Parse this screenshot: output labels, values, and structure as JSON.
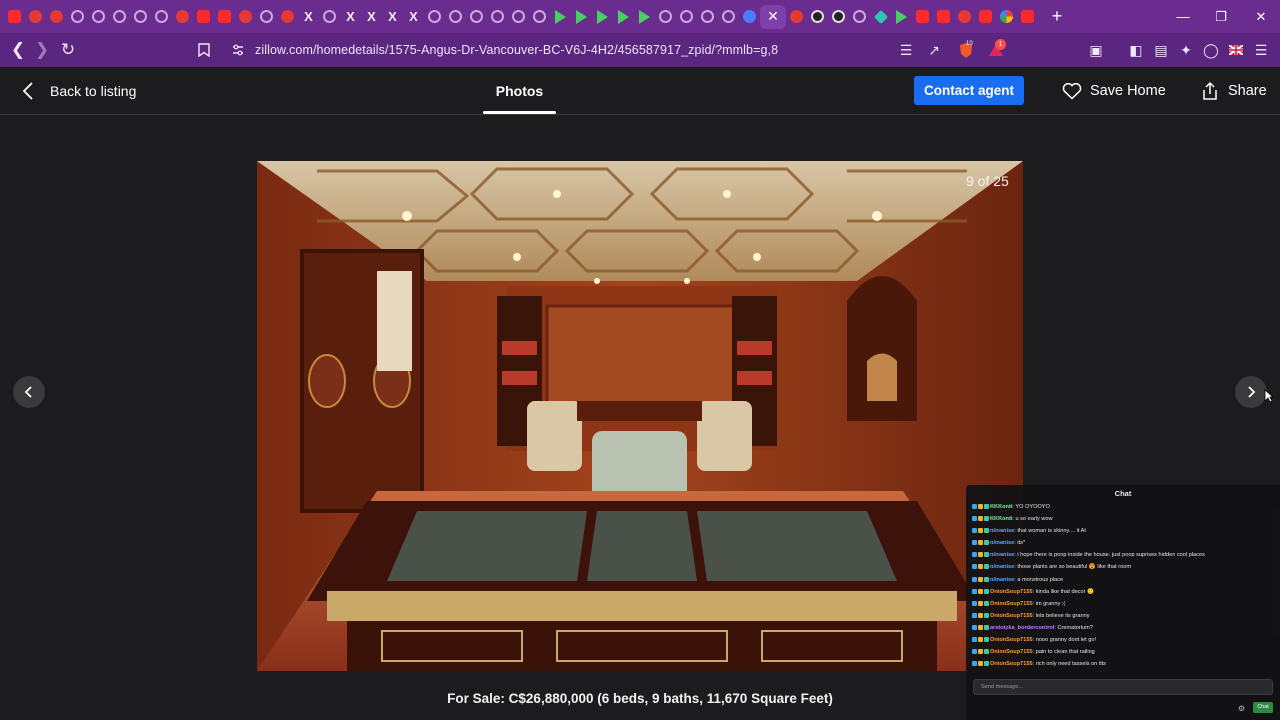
{
  "browser": {
    "url": "zillow.com/homedetails/1575-Angus-Dr-Vancouver-BC-V6J-4H2/456587917_zpid/?mmlb=g,8",
    "tab_icons": [
      "youtube-icon",
      "twitch-icon",
      "twitch-icon",
      "circle-icon",
      "circle-icon",
      "circle-icon",
      "circle-icon",
      "circle-icon",
      "twitch-icon",
      "youtube-icon",
      "youtube-icon",
      "twitch-icon",
      "circle-icon",
      "twitch-icon",
      "x-icon",
      "circle-icon",
      "x-icon",
      "x-icon",
      "x-icon",
      "x-icon",
      "circle-icon",
      "circle-icon",
      "circle-icon",
      "circle-icon",
      "circle-icon",
      "circle-icon",
      "play-icon",
      "play-icon",
      "play-icon",
      "play-icon",
      "play-icon",
      "circle-icon",
      "circle-icon",
      "circle-icon",
      "circle-icon",
      "blue-icon",
      "close-icon",
      "twitch-icon",
      "dark-icon",
      "dark-icon",
      "circle-icon",
      "pin-icon",
      "play-icon",
      "youtube-icon",
      "youtube-icon",
      "twitch-icon",
      "youtube-icon",
      "google-icon",
      "youtube-icon"
    ],
    "new_tab": "+",
    "brave_badge": "10",
    "alert_badge": "1"
  },
  "header": {
    "back_label": "Back to listing",
    "photos_tab": "Photos",
    "contact_label": "Contact agent",
    "save_label": "Save Home",
    "share_label": "Share"
  },
  "photo": {
    "counter": "9 of 25",
    "caption": "For Sale: C$26,880,000 (6 beds, 9 baths, 11,670 Square Feet)"
  },
  "chat": {
    "title": "Chat",
    "placeholder": "Send message...",
    "send_label": "Chat",
    "messages": [
      {
        "user": "KKKonti",
        "color": "#7cf5a2",
        "text": ": YO OYOOYO"
      },
      {
        "user": "KKKonti",
        "color": "#7cf5a2",
        "text": ": u so early wow"
      },
      {
        "user": "niinanise",
        "color": "#5aa9ff",
        "text": ": that woman is skinny.... it AI"
      },
      {
        "user": "niinanise",
        "color": "#5aa9ff",
        "text": ": its*"
      },
      {
        "user": "niinanise",
        "color": "#5aa9ff",
        "text": ": i hope there is poop inside the house. just poop suprises hidden cool places"
      },
      {
        "user": "niinanise",
        "color": "#5aa9ff",
        "text": ": those plants are so beautiful 😍 like that room"
      },
      {
        "user": "niinanise",
        "color": "#5aa9ff",
        "text": ": a monstrous place"
      },
      {
        "user": "OnionSoup7155",
        "color": "#ff9c3b",
        "text": ": kinda like that decor 🙂"
      },
      {
        "user": "OnionSoup7155",
        "color": "#ff9c3b",
        "text": ": im granny :("
      },
      {
        "user": "OnionSoup7155",
        "color": "#ff9c3b",
        "text": ": lets believe its granny"
      },
      {
        "user": "arstotzka_bordercontrol",
        "color": "#c77dff",
        "text": ": Crematorium?"
      },
      {
        "user": "OnionSoup7155",
        "color": "#ff9c3b",
        "text": ": nooo granny dont let go!"
      },
      {
        "user": "OnionSoup7155",
        "color": "#ff9c3b",
        "text": ": pain to clean that railing"
      },
      {
        "user": "OnionSoup7155",
        "color": "#ff9c3b",
        "text": ": rich only need tassels on tits"
      }
    ]
  },
  "colors": {
    "tabstrip": "#6a2c8f",
    "toolbar": "#5b2680",
    "page_bg": "#1c1c1e",
    "contact_button": "#1a6cf0"
  }
}
